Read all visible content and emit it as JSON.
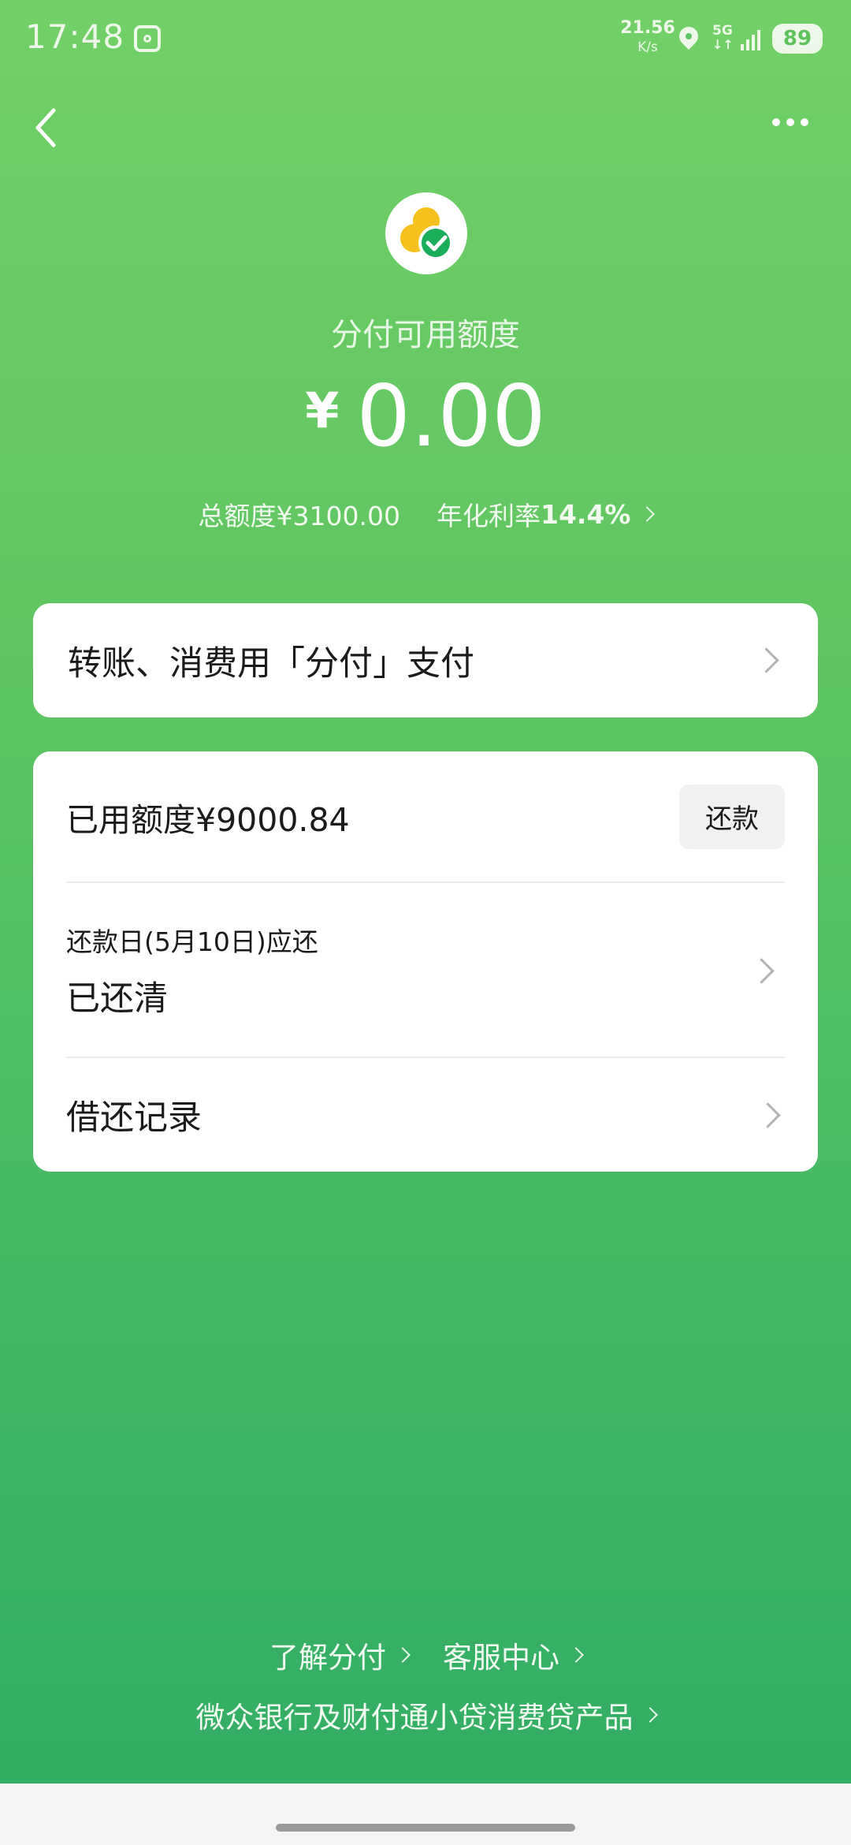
{
  "status_bar": {
    "time": "17:48",
    "speed_value": "21.56",
    "speed_unit": "K/s",
    "network": "5G",
    "battery": "89"
  },
  "header": {
    "back_icon": "chevron-left-icon",
    "more_icon": "more-dots-icon"
  },
  "credit": {
    "label": "分付可用额度",
    "currency_symbol": "¥",
    "available": "0.00",
    "total_limit_text": "总额度¥3100.00",
    "rate_label": "年化利率",
    "rate_value": "14.4%"
  },
  "pay_card": {
    "label": "转账、消费用「分付」支付"
  },
  "usage_card": {
    "used_text": "已用额度¥9000.84",
    "repay_button": "还款",
    "due_label": "还款日(5月10日)应还",
    "due_status": "已还清",
    "records_label": "借还记录"
  },
  "footer": {
    "learn_link": "了解分付",
    "service_link": "客服中心",
    "products_link": "微众银行及财付通小贷消费贷产品"
  },
  "colors": {
    "gradient_top": "#72d067",
    "gradient_bottom": "#2fac64",
    "logo_yellow": "#f6c11c",
    "logo_green": "#1aad5a"
  }
}
